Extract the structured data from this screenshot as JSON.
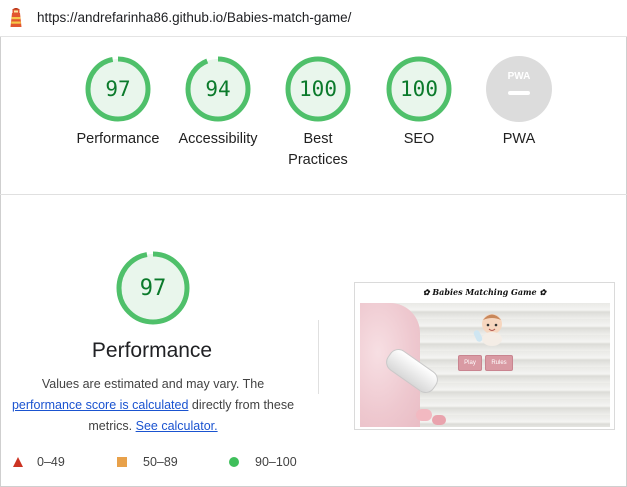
{
  "url": "https://andrefarinha86.github.io/Babies-match-game/",
  "colors": {
    "pass_ring": "#4fc06a",
    "pass_fill": "#e9f6ec",
    "pass_text": "#0b7a2b",
    "pwa_gray": "#dcdcdc",
    "fail": "#cc3322",
    "average": "#e8a14a",
    "good": "#3fbf5b",
    "link": "#1a53d0"
  },
  "categories": [
    {
      "label": "Performance",
      "score": "97",
      "fraction": 0.97
    },
    {
      "label": "Accessibility",
      "score": "94",
      "fraction": 0.94
    },
    {
      "label": "Best Practices",
      "score": "100",
      "fraction": 1.0
    },
    {
      "label": "SEO",
      "score": "100",
      "fraction": 1.0
    },
    {
      "label": "PWA",
      "badge": "PWA",
      "icon": "pwa-badge-icon"
    }
  ],
  "performance": {
    "score": "97",
    "fraction": 0.97,
    "title": "Performance",
    "desc_part1": "Values are estimated and may vary. The",
    "link1": "performance score is calculated",
    "desc_part2": "directly from these metrics.",
    "link2": "See calculator."
  },
  "legend": [
    {
      "range": "0–49",
      "icon": "triangle-icon"
    },
    {
      "range": "50–89",
      "icon": "square-icon"
    },
    {
      "range": "90–100",
      "icon": "circle-icon"
    }
  ],
  "screenshot": {
    "title": "Babies Matching Game",
    "play_label": "Play",
    "rules_label": "Rules"
  }
}
